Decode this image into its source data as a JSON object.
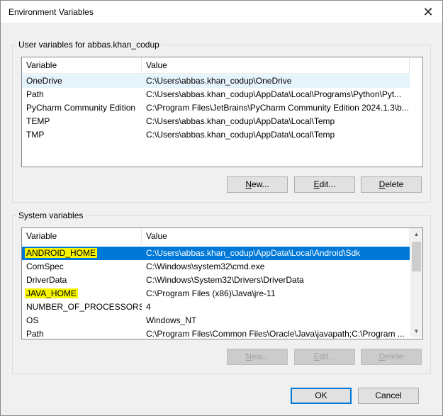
{
  "window": {
    "title": "Environment Variables",
    "close_glyph": "✕"
  },
  "user_section": {
    "label": "User variables for abbas.khan_codup",
    "columns": [
      "Variable",
      "Value"
    ],
    "rows": [
      {
        "variable": "OneDrive",
        "value": "C:\\Users\\abbas.khan_codup\\OneDrive"
      },
      {
        "variable": "Path",
        "value": "C:\\Users\\abbas.khan_codup\\AppData\\Local\\Programs\\Python\\Pyt..."
      },
      {
        "variable": "PyCharm Community Edition",
        "value": "C:\\Program Files\\JetBrains\\PyCharm Community Edition 2024.1.3\\b..."
      },
      {
        "variable": "TEMP",
        "value": "C:\\Users\\abbas.khan_codup\\AppData\\Local\\Temp"
      },
      {
        "variable": "TMP",
        "value": "C:\\Users\\abbas.khan_codup\\AppData\\Local\\Temp"
      }
    ],
    "buttons": {
      "new_prefix": "N",
      "new_rest": "ew...",
      "edit_prefix": "E",
      "edit_rest": "dit...",
      "delete_prefix": "D",
      "delete_rest": "elete"
    }
  },
  "system_section": {
    "label": "System variables",
    "columns": [
      "Variable",
      "Value"
    ],
    "rows": [
      {
        "variable": "ANDROID_HOME",
        "value": "C:\\Users\\abbas.khan_codup\\AppData\\Local\\Android\\Sdk"
      },
      {
        "variable": "ComSpec",
        "value": "C:\\Windows\\system32\\cmd.exe"
      },
      {
        "variable": "DriverData",
        "value": "C:\\Windows\\System32\\Drivers\\DriverData"
      },
      {
        "variable": "JAVA_HOME",
        "value": "C:\\Program Files (x86)\\Java\\jre-11"
      },
      {
        "variable": "NUMBER_OF_PROCESSORS",
        "value": "4"
      },
      {
        "variable": "OS",
        "value": "Windows_NT"
      },
      {
        "variable": "Path",
        "value": "C:\\Program Files\\Common Files\\Oracle\\Java\\javapath;C:\\Program ..."
      }
    ],
    "buttons": {
      "new_prefix": "N",
      "new_rest": "ew...",
      "edit_prefix": "E",
      "edit_rest": "dit...",
      "delete_prefix": "D",
      "delete_rest": "elete"
    }
  },
  "footer": {
    "ok_label": "OK",
    "cancel_label": "Cancel"
  },
  "colors": {
    "selection": "#0078d7",
    "highlight": "#f5f500",
    "hover_row": "#e5f3fb"
  },
  "icons": {
    "close": "close-icon",
    "scroll_up": "chevron-up-icon",
    "scroll_down": "chevron-down-icon"
  }
}
